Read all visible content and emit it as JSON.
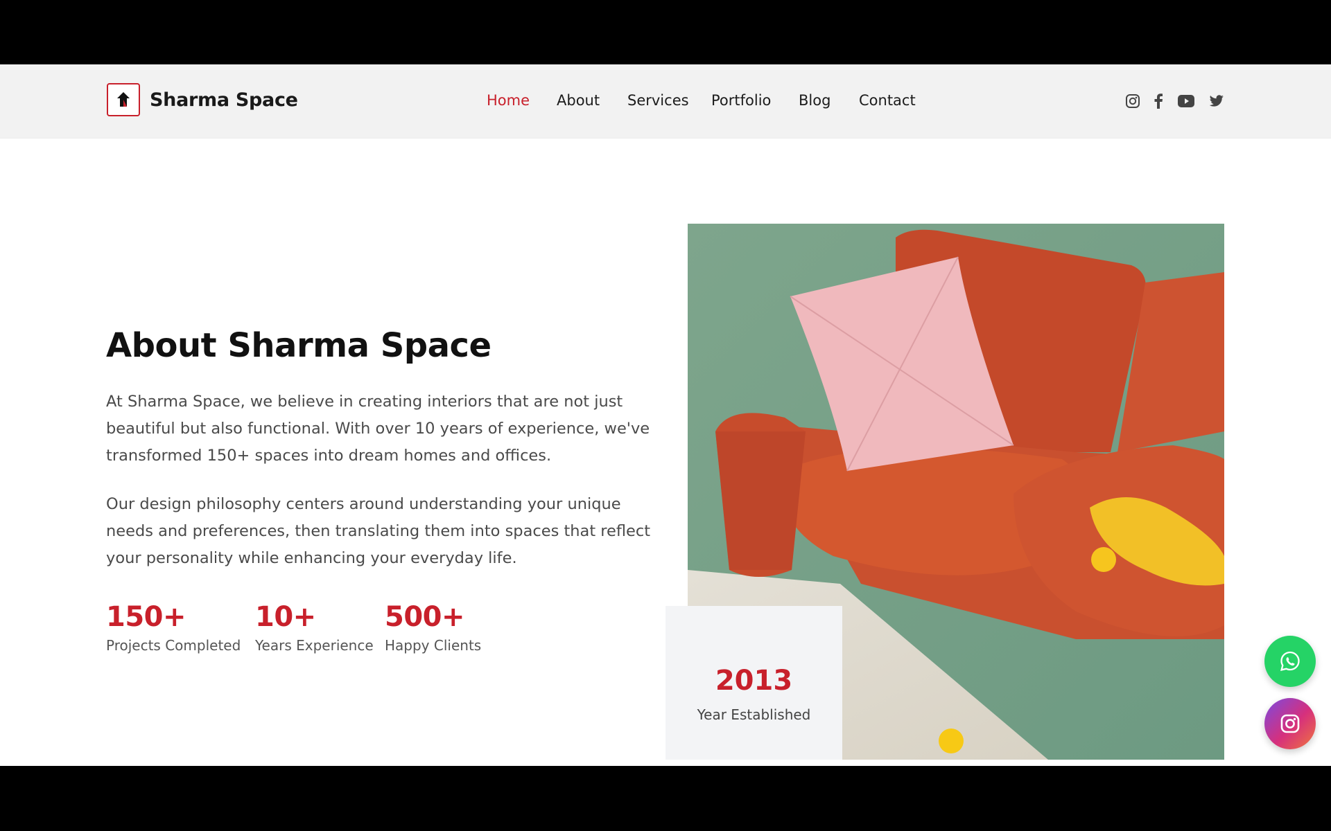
{
  "brand": {
    "name": "Sharma Space"
  },
  "nav": {
    "items": [
      {
        "label": "Home",
        "active": true
      },
      {
        "label": "About"
      },
      {
        "label": "Services"
      },
      {
        "label": "Portfolio"
      },
      {
        "label": "Blog"
      },
      {
        "label": "Contact"
      }
    ]
  },
  "social": [
    "instagram-icon",
    "facebook-icon",
    "youtube-icon",
    "twitter-icon"
  ],
  "about": {
    "title": "About Sharma Space",
    "paragraph_1": "At Sharma Space, we believe in creating interiors that are not just beautiful but also functional. With over 10 years of experience, we've transformed 150+ spaces into dream homes and offices.",
    "paragraph_2": "Our design philosophy centers around understanding your unique needs and preferences, then translating them into spaces that reflect your personality while enhancing your everyday life."
  },
  "stats": [
    {
      "value": "150+",
      "label": "Projects Completed"
    },
    {
      "value": "10+",
      "label": "Years Experience"
    },
    {
      "value": "500+",
      "label": "Happy Clients"
    }
  ],
  "established": {
    "year": "2013",
    "label": "Year Established"
  },
  "floating_buttons": [
    "whatsapp-icon",
    "instagram-icon"
  ],
  "colors": {
    "accent": "#c8202b",
    "whatsapp": "#25d366",
    "nav_bg": "#f2f2f2",
    "wall": "#7fa28a",
    "sofa": "#c9502f"
  }
}
